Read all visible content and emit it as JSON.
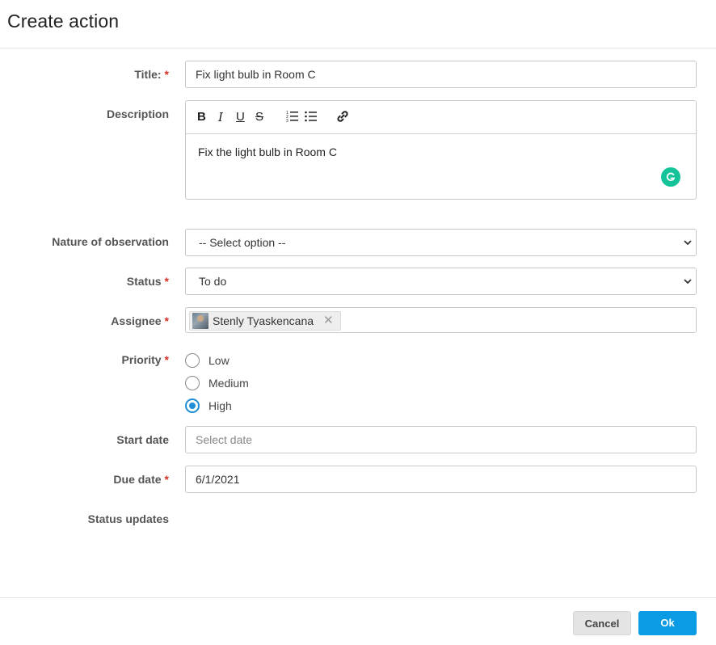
{
  "dialog": {
    "title": "Create action"
  },
  "form": {
    "title": {
      "label": "Title:",
      "value": "Fix light bulb in Room C"
    },
    "description": {
      "label": "Description",
      "toolbar": {
        "bold": "B",
        "italic": "I",
        "underline": "U",
        "strike": "S"
      },
      "value": "Fix the light bulb in Room C"
    },
    "nature": {
      "label": "Nature of observation",
      "selected": "-- Select option --"
    },
    "status": {
      "label": "Status",
      "selected": "To do"
    },
    "assignee": {
      "label": "Assignee",
      "tag": "Stenly Tyaskencana",
      "remove": "✕"
    },
    "priority": {
      "label": "Priority",
      "options": [
        "Low",
        "Medium",
        "High"
      ],
      "selected": "High"
    },
    "start_date": {
      "label": "Start date",
      "placeholder": "Select date"
    },
    "due_date": {
      "label": "Due date",
      "value": "6/1/2021"
    },
    "status_updates": {
      "label": "Status updates"
    },
    "required_marker": "*"
  },
  "footer": {
    "cancel_label": "Cancel",
    "ok_label": "Ok"
  },
  "colors": {
    "accent": "#0a9be4",
    "required": "#d93025",
    "grammarly": "#15c39a"
  }
}
